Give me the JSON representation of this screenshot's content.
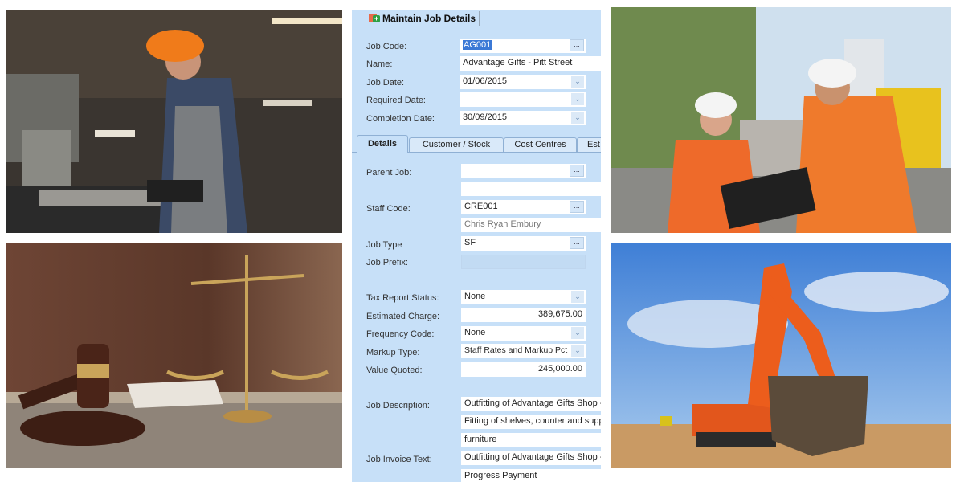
{
  "window": {
    "title": "Maintain Job Details",
    "icon": "add-job-icon"
  },
  "header_fields": [
    {
      "label": "Job Code:",
      "value": "AG001",
      "control": "lookup",
      "selected": true
    },
    {
      "label": "Name:",
      "value": "Advantage Gifts - Pitt Street",
      "control": "text"
    },
    {
      "label": "Job Date:",
      "value": "01/06/2015",
      "control": "date-dropdown"
    },
    {
      "label": "Required Date:",
      "value": "",
      "control": "date-dropdown"
    },
    {
      "label": "Completion Date:",
      "value": "30/09/2015",
      "control": "date-dropdown"
    }
  ],
  "tabs": [
    {
      "label": "Details",
      "active": true
    },
    {
      "label": "Customer / Stock",
      "active": false
    },
    {
      "label": "Cost Centres",
      "active": false
    },
    {
      "label": "Est",
      "active": false
    }
  ],
  "details": {
    "parent_job": {
      "label": "Parent Job:",
      "value": "",
      "description": ""
    },
    "staff_code": {
      "label": "Staff Code:",
      "value": "CRE001",
      "description": "Chris Ryan Embury"
    },
    "job_type": {
      "label": "Job Type",
      "value": "SF"
    },
    "job_prefix": {
      "label": "Job Prefix:",
      "value": ""
    },
    "tax_report_status": {
      "label": "Tax Report Status:",
      "value": "None"
    },
    "estimated_charge": {
      "label": "Estimated Charge:",
      "value": "389,675.00"
    },
    "frequency_code": {
      "label": "Frequency Code:",
      "value": "None"
    },
    "markup_type": {
      "label": "Markup Type:",
      "value": "Staff Rates and Markup Pct"
    },
    "value_quoted": {
      "label": "Value Quoted:",
      "value": "245,000.00"
    },
    "job_description": {
      "label": "Job Description:",
      "lines": [
        "Outfitting of Advantage Gifts Shop -",
        "Fitting of shelves, counter and suppl",
        "furniture"
      ]
    },
    "job_invoice_text": {
      "label": "Job Invoice Text:",
      "lines": [
        "Outfitting of Advantage Gifts Shop -",
        "Progress Payment"
      ]
    }
  },
  "buttons": {
    "lookup": "...",
    "dropdown": "⌄"
  },
  "photos": [
    {
      "subject": "machinist-at-drill-press"
    },
    {
      "subject": "gavel-and-scales-of-justice"
    },
    {
      "subject": "construction-workers-with-tablet"
    },
    {
      "subject": "excavator-on-site"
    }
  ],
  "colors": {
    "panel_bg": "#c7e0f8",
    "selection": "#3b79d6"
  }
}
